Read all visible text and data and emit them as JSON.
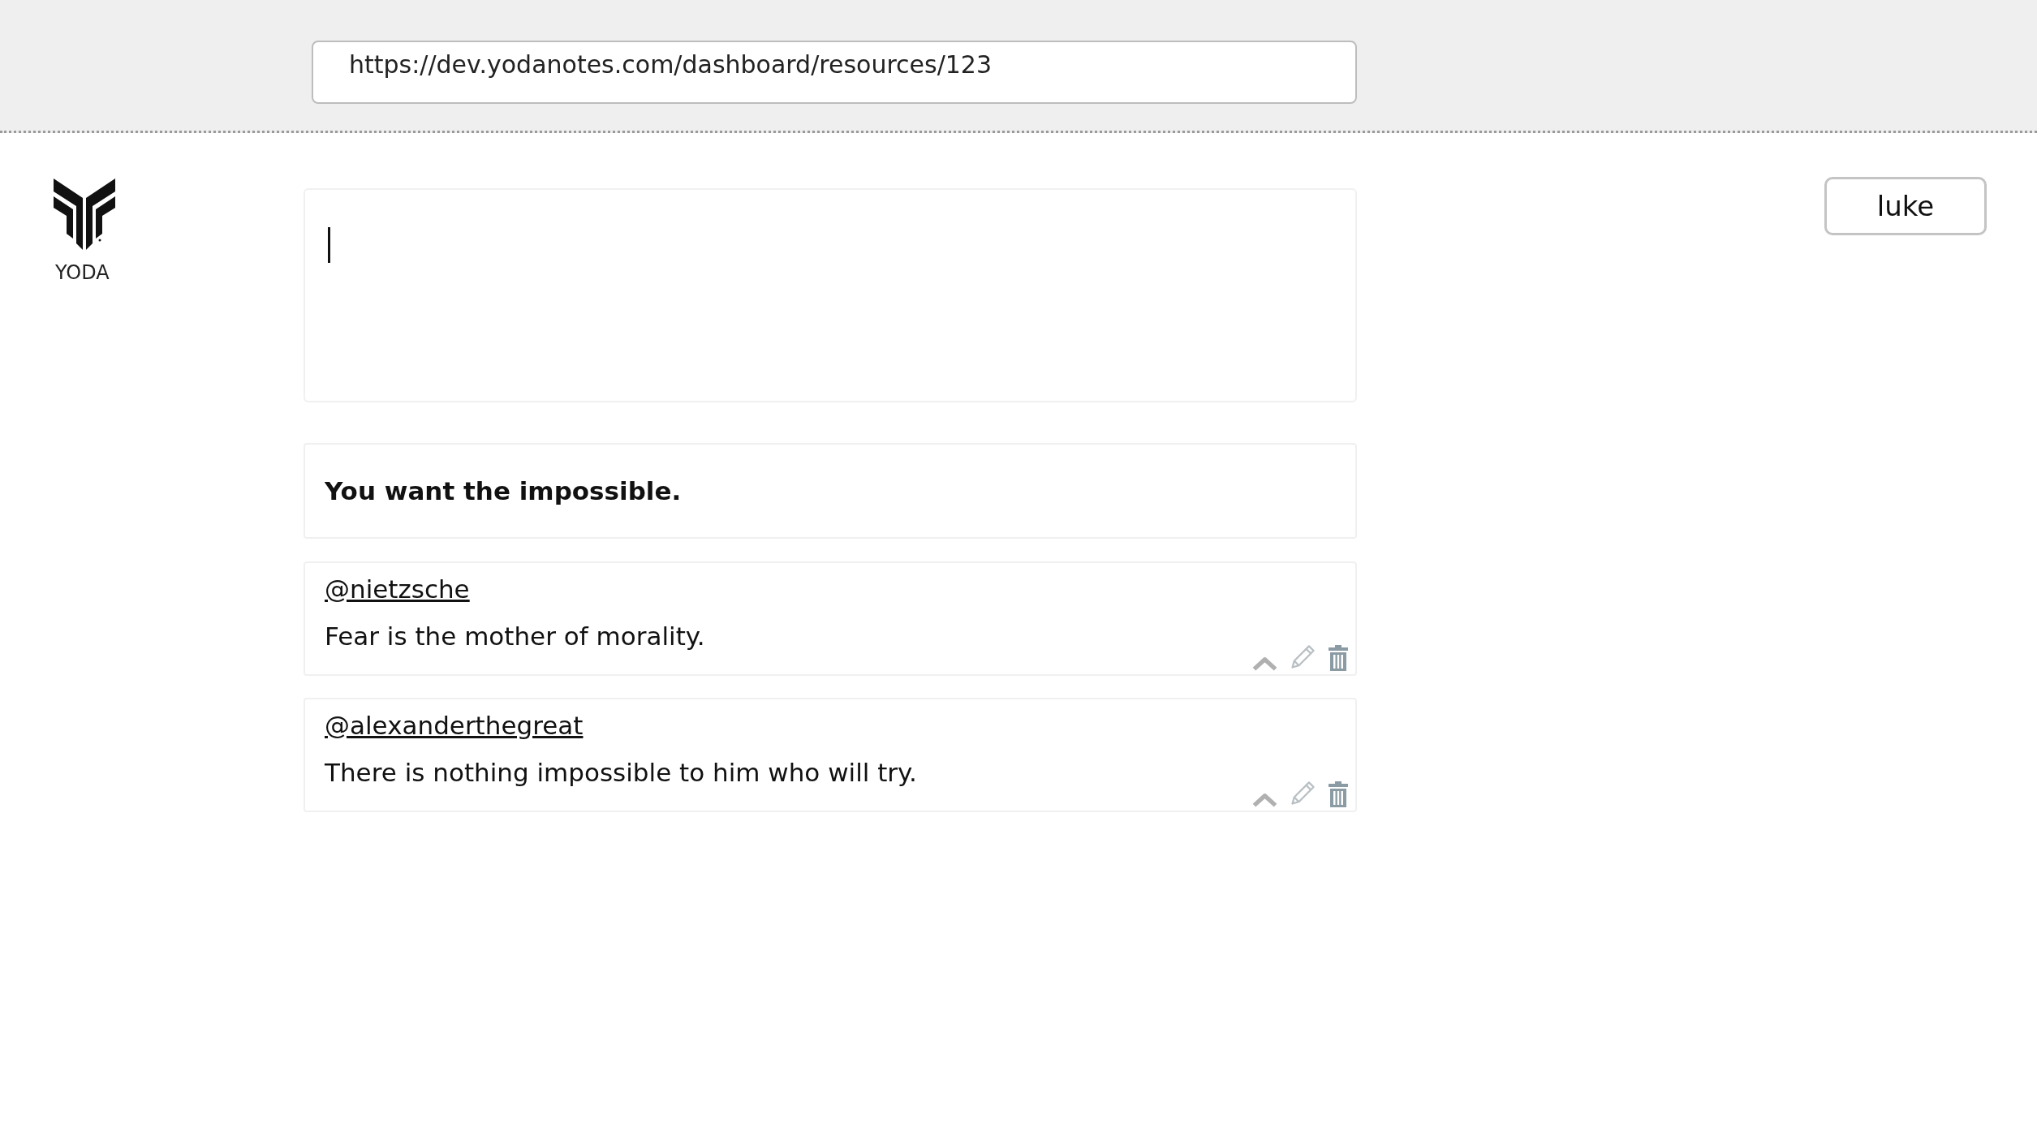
{
  "address_bar": {
    "url": "https://dev.yodanotes.com/dashboard/resources/123"
  },
  "logo": {
    "text": "YODA"
  },
  "user_button": {
    "label": "luke"
  },
  "editor": {
    "focused": true
  },
  "question": {
    "text": "You want the impossible."
  },
  "comments": [
    {
      "author": "@nietzsche",
      "text": "Fear is the mother of morality."
    },
    {
      "author": "@alexanderthegreat",
      "text": "There is nothing impossible to him who will try."
    }
  ]
}
